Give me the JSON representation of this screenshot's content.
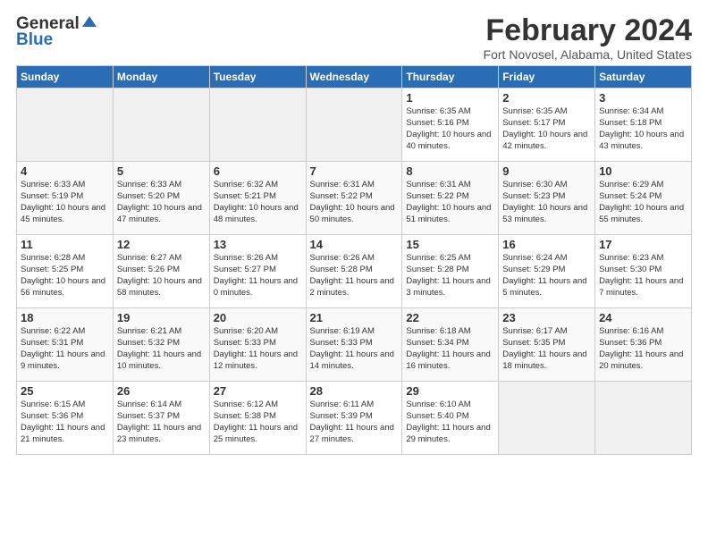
{
  "logo": {
    "general": "General",
    "blue": "Blue"
  },
  "title": "February 2024",
  "location": "Fort Novosel, Alabama, United States",
  "days_of_week": [
    "Sunday",
    "Monday",
    "Tuesday",
    "Wednesday",
    "Thursday",
    "Friday",
    "Saturday"
  ],
  "weeks": [
    [
      {
        "day": "",
        "empty": true
      },
      {
        "day": "",
        "empty": true
      },
      {
        "day": "",
        "empty": true
      },
      {
        "day": "",
        "empty": true
      },
      {
        "day": "1",
        "sunrise": "6:35 AM",
        "sunset": "5:16 PM",
        "daylight": "10 hours and 40 minutes."
      },
      {
        "day": "2",
        "sunrise": "6:35 AM",
        "sunset": "5:17 PM",
        "daylight": "10 hours and 42 minutes."
      },
      {
        "day": "3",
        "sunrise": "6:34 AM",
        "sunset": "5:18 PM",
        "daylight": "10 hours and 43 minutes."
      }
    ],
    [
      {
        "day": "4",
        "sunrise": "6:33 AM",
        "sunset": "5:19 PM",
        "daylight": "10 hours and 45 minutes."
      },
      {
        "day": "5",
        "sunrise": "6:33 AM",
        "sunset": "5:20 PM",
        "daylight": "10 hours and 47 minutes."
      },
      {
        "day": "6",
        "sunrise": "6:32 AM",
        "sunset": "5:21 PM",
        "daylight": "10 hours and 48 minutes."
      },
      {
        "day": "7",
        "sunrise": "6:31 AM",
        "sunset": "5:22 PM",
        "daylight": "10 hours and 50 minutes."
      },
      {
        "day": "8",
        "sunrise": "6:31 AM",
        "sunset": "5:22 PM",
        "daylight": "10 hours and 51 minutes."
      },
      {
        "day": "9",
        "sunrise": "6:30 AM",
        "sunset": "5:23 PM",
        "daylight": "10 hours and 53 minutes."
      },
      {
        "day": "10",
        "sunrise": "6:29 AM",
        "sunset": "5:24 PM",
        "daylight": "10 hours and 55 minutes."
      }
    ],
    [
      {
        "day": "11",
        "sunrise": "6:28 AM",
        "sunset": "5:25 PM",
        "daylight": "10 hours and 56 minutes."
      },
      {
        "day": "12",
        "sunrise": "6:27 AM",
        "sunset": "5:26 PM",
        "daylight": "10 hours and 58 minutes."
      },
      {
        "day": "13",
        "sunrise": "6:26 AM",
        "sunset": "5:27 PM",
        "daylight": "11 hours and 0 minutes."
      },
      {
        "day": "14",
        "sunrise": "6:26 AM",
        "sunset": "5:28 PM",
        "daylight": "11 hours and 2 minutes."
      },
      {
        "day": "15",
        "sunrise": "6:25 AM",
        "sunset": "5:28 PM",
        "daylight": "11 hours and 3 minutes."
      },
      {
        "day": "16",
        "sunrise": "6:24 AM",
        "sunset": "5:29 PM",
        "daylight": "11 hours and 5 minutes."
      },
      {
        "day": "17",
        "sunrise": "6:23 AM",
        "sunset": "5:30 PM",
        "daylight": "11 hours and 7 minutes."
      }
    ],
    [
      {
        "day": "18",
        "sunrise": "6:22 AM",
        "sunset": "5:31 PM",
        "daylight": "11 hours and 9 minutes."
      },
      {
        "day": "19",
        "sunrise": "6:21 AM",
        "sunset": "5:32 PM",
        "daylight": "11 hours and 10 minutes."
      },
      {
        "day": "20",
        "sunrise": "6:20 AM",
        "sunset": "5:33 PM",
        "daylight": "11 hours and 12 minutes."
      },
      {
        "day": "21",
        "sunrise": "6:19 AM",
        "sunset": "5:33 PM",
        "daylight": "11 hours and 14 minutes."
      },
      {
        "day": "22",
        "sunrise": "6:18 AM",
        "sunset": "5:34 PM",
        "daylight": "11 hours and 16 minutes."
      },
      {
        "day": "23",
        "sunrise": "6:17 AM",
        "sunset": "5:35 PM",
        "daylight": "11 hours and 18 minutes."
      },
      {
        "day": "24",
        "sunrise": "6:16 AM",
        "sunset": "5:36 PM",
        "daylight": "11 hours and 20 minutes."
      }
    ],
    [
      {
        "day": "25",
        "sunrise": "6:15 AM",
        "sunset": "5:36 PM",
        "daylight": "11 hours and 21 minutes."
      },
      {
        "day": "26",
        "sunrise": "6:14 AM",
        "sunset": "5:37 PM",
        "daylight": "11 hours and 23 minutes."
      },
      {
        "day": "27",
        "sunrise": "6:12 AM",
        "sunset": "5:38 PM",
        "daylight": "11 hours and 25 minutes."
      },
      {
        "day": "28",
        "sunrise": "6:11 AM",
        "sunset": "5:39 PM",
        "daylight": "11 hours and 27 minutes."
      },
      {
        "day": "29",
        "sunrise": "6:10 AM",
        "sunset": "5:40 PM",
        "daylight": "11 hours and 29 minutes."
      },
      {
        "day": "",
        "empty": true
      },
      {
        "day": "",
        "empty": true
      }
    ]
  ]
}
